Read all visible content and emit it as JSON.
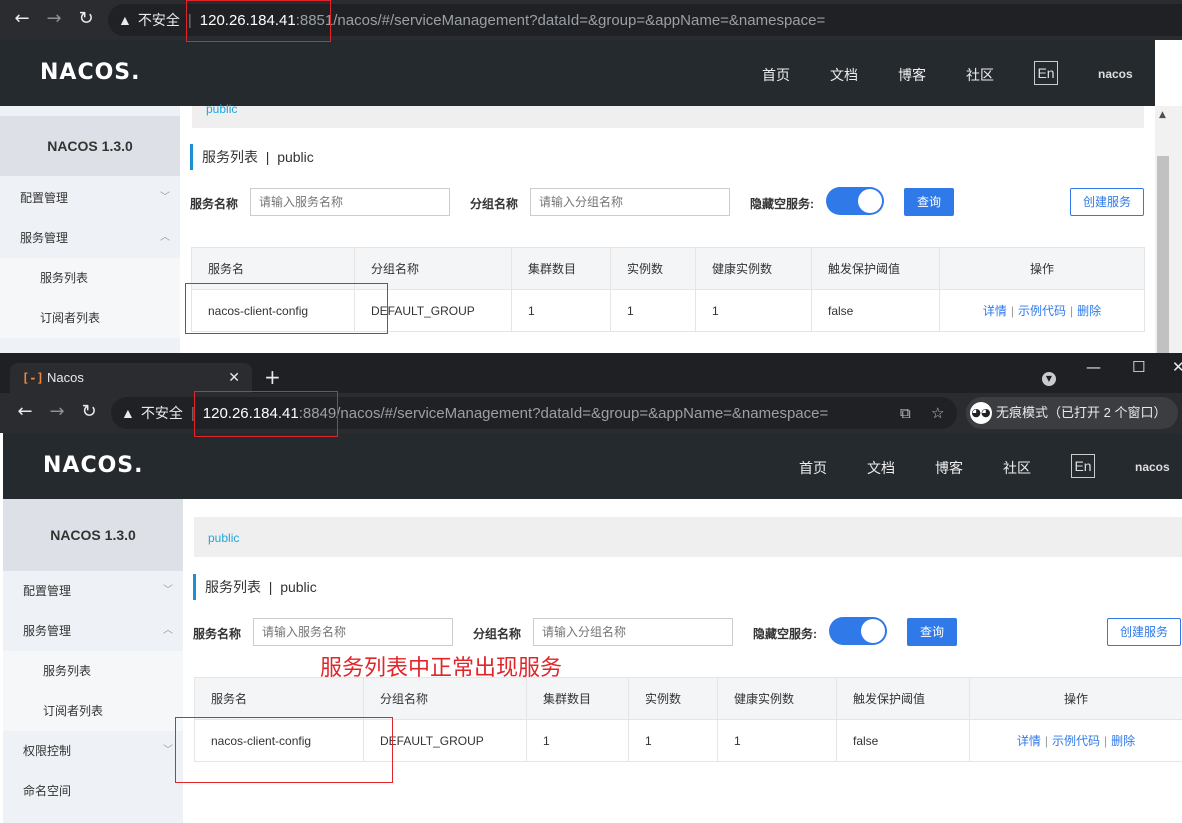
{
  "top_window": {
    "address": {
      "security_label": "不安全",
      "host": "120.26.184.41",
      "port": ":8851",
      "path": "/nacos/#/serviceManagement?dataId=&group=&appName=&namespace="
    },
    "header": {
      "logo_text": "NACOS.",
      "nav": [
        "首页",
        "文档",
        "博客",
        "社区"
      ],
      "lang_button": "En",
      "user": "nacos"
    },
    "sidebar": {
      "version": "NACOS 1.3.0",
      "items": [
        "配置管理",
        "服务管理",
        "服务列表",
        "订阅者列表"
      ]
    },
    "namespace_label": "public",
    "page_title": "服务列表",
    "page_title_sep": "|",
    "page_namespace": "public",
    "filters": {
      "service_name_label": "服务名称",
      "service_name_placeholder": "请输入服务名称",
      "group_name_label": "分组名称",
      "group_name_placeholder": "请输入分组名称",
      "hide_empty_label": "隐藏空服务:",
      "hide_empty_on": true,
      "query_button": "查询",
      "create_button": "创建服务"
    },
    "table": {
      "headers": [
        "服务名",
        "分组名称",
        "集群数目",
        "实例数",
        "健康实例数",
        "触发保护阈值",
        "操作"
      ],
      "rows": [
        {
          "name": "nacos-client-config",
          "group": "DEFAULT_GROUP",
          "clusters": "1",
          "instances": "1",
          "healthy": "1",
          "threshold": "false",
          "ops": {
            "detail": "详情",
            "sample": "示例代码",
            "delete": "删除",
            "sep": "|"
          }
        }
      ]
    }
  },
  "bottom_window": {
    "tab": {
      "favicon": "[-]",
      "title": "Nacos",
      "close": "✕",
      "new_tab": "+"
    },
    "window_controls": {
      "minimize": "—",
      "maximize": "☐",
      "close": "✕"
    },
    "address": {
      "security_label": "不安全",
      "host": "120.26.184.41",
      "port": ":8849",
      "path": "/nacos/#/serviceManagement?dataId=&group=&appName=&namespace=",
      "incognito_label": "无痕模式（已打开 2 个窗口）"
    },
    "header": {
      "logo_text": "NACOS.",
      "nav": [
        "首页",
        "文档",
        "博客",
        "社区"
      ],
      "lang_button": "En",
      "user": "nacos"
    },
    "sidebar": {
      "version": "NACOS 1.3.0",
      "items": [
        "配置管理",
        "服务管理",
        "服务列表",
        "订阅者列表",
        "权限控制",
        "命名空间"
      ]
    },
    "namespace_label": "public",
    "page_title": "服务列表",
    "page_title_sep": "|",
    "page_namespace": "public",
    "filters": {
      "service_name_label": "服务名称",
      "service_name_placeholder": "请输入服务名称",
      "group_name_label": "分组名称",
      "group_name_placeholder": "请输入分组名称",
      "hide_empty_label": "隐藏空服务:",
      "hide_empty_on": true,
      "query_button": "查询",
      "create_button": "创建服务"
    },
    "table": {
      "headers": [
        "服务名",
        "分组名称",
        "集群数目",
        "实例数",
        "健康实例数",
        "触发保护阈值",
        "操作"
      ],
      "rows": [
        {
          "name": "nacos-client-config",
          "group": "DEFAULT_GROUP",
          "clusters": "1",
          "instances": "1",
          "healthy": "1",
          "threshold": "false",
          "ops": {
            "detail": "详情",
            "sample": "示例代码",
            "delete": "删除",
            "sep": "|"
          }
        }
      ]
    }
  },
  "annotation": {
    "text": "服务列表中正常出现服务",
    "color": "#e0262a"
  },
  "colors": {
    "header_bg": "#252a2f",
    "accent_blue": "#2f79e8",
    "namespace_blue": "#23a6dc",
    "annotation_red": "#e0262a"
  }
}
